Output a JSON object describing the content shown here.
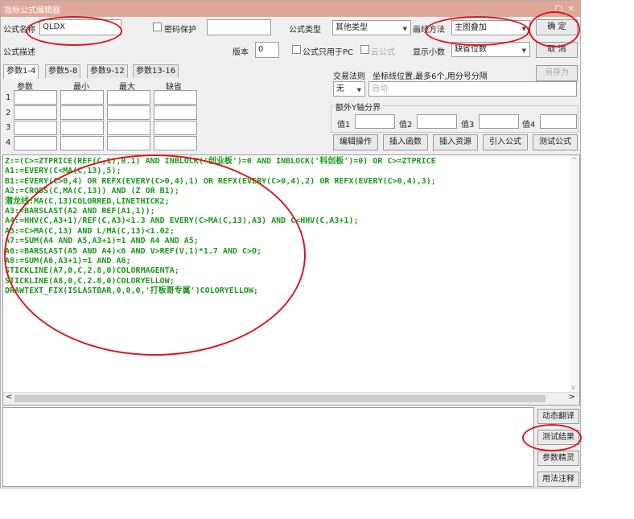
{
  "window": {
    "title": "指标公式编辑器",
    "controls": [
      "□",
      "×"
    ]
  },
  "form": {
    "name_label": "公式名称",
    "name_value": "QLDX",
    "password_label": "密码保护",
    "type_label": "公式类型",
    "type_value": "其他类型",
    "draw_label": "画线方法",
    "draw_value": "主图叠加",
    "confirm_label": "确  定",
    "cancel_label": "取  消",
    "saveas_label": "另存为",
    "desc_label": "公式描述",
    "version_label": "版本",
    "version_value": "0",
    "pc_only_label": "公式只用于PC",
    "cloud_label": "云公式",
    "decimals_label": "显示小数",
    "decimals_value": "缺省位数"
  },
  "tabs": [
    "参数1-4",
    "参数5-8",
    "参数9-12",
    "参数13-16"
  ],
  "params": {
    "headers": [
      "参数",
      "最小",
      "最大",
      "缺省"
    ],
    "rows": [
      "1",
      "2",
      "3",
      "4"
    ]
  },
  "right_panel": {
    "trade_rule_label": "交易法则",
    "axis_hint": "坐标线位置,最多6个,用分号分隔",
    "axis_select": "无",
    "axis_auto": "自动",
    "extra_axis_label": "额外Y轴分界",
    "value_labels": [
      "值1",
      "值2",
      "值3",
      "值4"
    ],
    "buttons": [
      "编辑操作",
      "插入函数",
      "插入资源",
      "引入公式",
      "测试公式"
    ]
  },
  "code_lines": [
    "Z:=(C>=ZTPRICE(REF(C,1),0.1) AND INBLOCK('创业板')=0 AND INBLOCK('科创板')=0) OR C>=ZTPRICE",
    "A1:=EVERY(C<MA(C,13),5);",
    "B1:=EVERY(C>0,4) OR REFX(EVERY(C>0,4),1) OR REFX(EVERY(C>0,4),2) OR REFX(EVERY(C>0,4),3);",
    "A2:=CROSS(C,MA(C,13)) AND (Z OR B1);",
    "潜龙线:MA(C,13)COLORRED,LINETHICK2;",
    "A3:=BARSLAST(A2 AND REF(A1,1));",
    "A4:=HHV(C,A3+1)/REF(C,A3)<1.3 AND EVERY(C>MA(C,13),A3) AND C<HHV(C,A3+1);",
    "A5:=C>MA(C,13) AND L/MA(C,13)<1.02;",
    "A7:=SUM(A4 AND A5,A3+1)=1 AND A4 AND A5;",
    "A6:=BARSLAST(A5 AND A4)<6 AND V>REF(V,1)*1.7 AND C>O;",
    "A8:=SUM(A6,A3+1)=1 AND A6;",
    "STICKLINE(A7,0,C,2.8,0)COLORMAGENTA;",
    "STICKLINE(A8,0,C,2.8,0)COLORYELLOW;",
    "DRAWTEXT_FIX(ISLASTBAR,0,0,0,'打板哥专属')COLORYELLOW;"
  ],
  "side_buttons": [
    "动态翻译",
    "测试结果",
    "参数精灵",
    "用法注释"
  ],
  "scroll": {
    "left_arrow": "<",
    "right_arrow": ">",
    "up_arrow": "^",
    "down_arrow": "v"
  },
  "colors": {
    "titlebar": "#e0a899",
    "code_green": "#1a9a1a",
    "annotation_red": "#d7191f"
  }
}
